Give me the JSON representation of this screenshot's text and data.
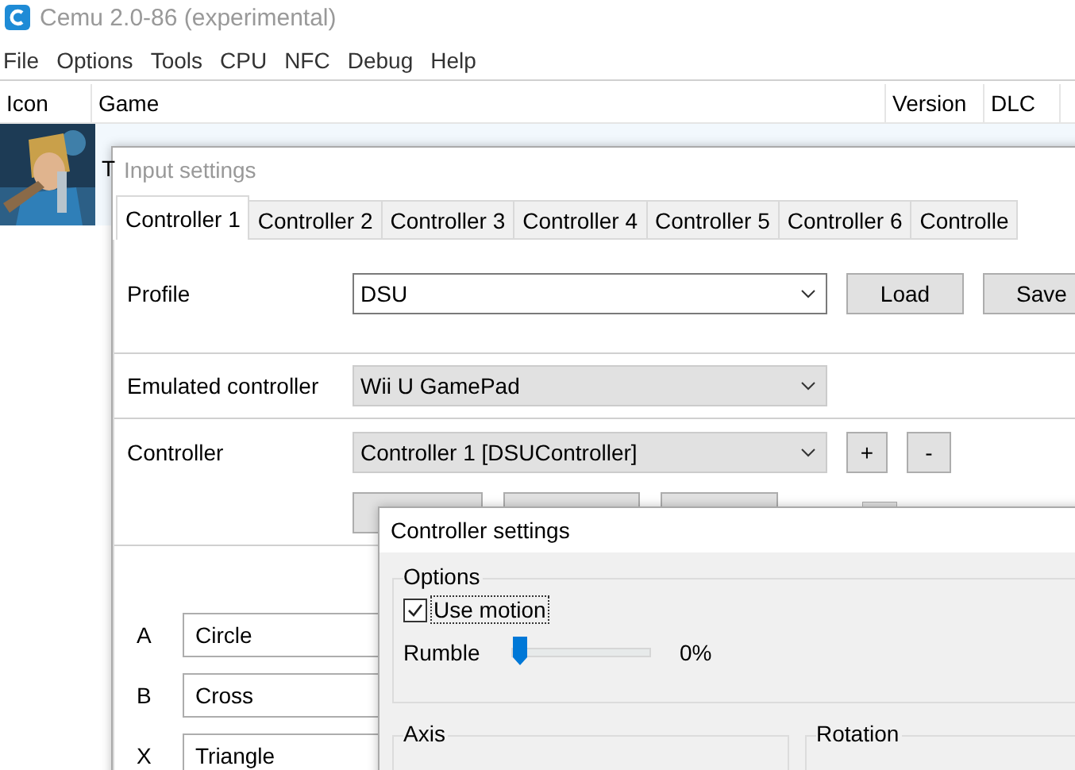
{
  "window": {
    "title": "Cemu 2.0-86 (experimental)"
  },
  "menu": [
    "File",
    "Options",
    "Tools",
    "CPU",
    "NFC",
    "Debug",
    "Help"
  ],
  "game_list": {
    "columns": [
      "Icon",
      "Game",
      "Version",
      "DLC"
    ],
    "rows": [
      {
        "game": "T"
      }
    ]
  },
  "input_settings": {
    "title": "Input settings",
    "tabs": [
      {
        "label": "Controller 1",
        "selected": true
      },
      {
        "label": "Controller 2",
        "selected": false
      },
      {
        "label": "Controller 3",
        "selected": false
      },
      {
        "label": "Controller 4",
        "selected": false
      },
      {
        "label": "Controller 5",
        "selected": false
      },
      {
        "label": "Controller 6",
        "selected": false
      },
      {
        "label": "Controlle",
        "selected": false
      }
    ],
    "profile": {
      "label": "Profile",
      "value": "DSU",
      "buttons": [
        "Load",
        "Save"
      ]
    },
    "emulated_controller": {
      "label": "Emulated controller",
      "value": "Wii U GamePad"
    },
    "controller": {
      "label": "Controller",
      "value": "Controller 1 [DSUController]",
      "buttons": [
        "+",
        "-"
      ]
    },
    "mappings": [
      {
        "key": "A",
        "value": "Circle"
      },
      {
        "key": "B",
        "value": "Cross"
      },
      {
        "key": "X",
        "value": "Triangle"
      }
    ]
  },
  "controller_settings": {
    "title": "Controller settings",
    "options": {
      "title": "Options",
      "use_motion": {
        "label": "Use motion",
        "checked": true
      },
      "rumble": {
        "label": "Rumble",
        "level": 0,
        "reading": "0%"
      }
    },
    "groups": [
      "Axis",
      "Rotation"
    ]
  }
}
